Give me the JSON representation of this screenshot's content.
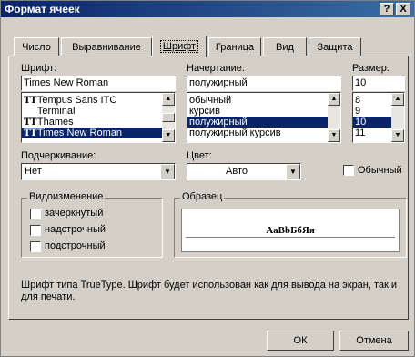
{
  "window": {
    "title": "Формат ячеек",
    "help": "?",
    "close": "X"
  },
  "tabs": [
    "Число",
    "Выравнивание",
    "Шрифт",
    "Граница",
    "Вид",
    "Защита"
  ],
  "font": {
    "label": "Шрифт:",
    "value": "Times New Roman",
    "items": [
      {
        "icon": "TT",
        "name": "Tempus Sans ITC"
      },
      {
        "icon": "",
        "name": "Terminal"
      },
      {
        "icon": "TT",
        "name": "Thames"
      },
      {
        "icon": "TT",
        "name": "Times New Roman"
      }
    ]
  },
  "style": {
    "label": "Начертание:",
    "value": "полужирный",
    "items": [
      "обычный",
      "курсив",
      "полужирный",
      "полужирный курсив"
    ]
  },
  "size": {
    "label": "Размер:",
    "value": "10",
    "items": [
      "8",
      "9",
      "10",
      "11"
    ]
  },
  "underline": {
    "label": "Подчеркивание:",
    "value": "Нет"
  },
  "color": {
    "label": "Цвет:",
    "value": "Авто"
  },
  "normal": {
    "label": "Обычный"
  },
  "effects": {
    "label": "Видоизменение",
    "items": [
      "зачеркнутый",
      "надстрочный",
      "подстрочный"
    ]
  },
  "sample": {
    "label": "Образец",
    "text": "AaBbБбЯя"
  },
  "note": "Шрифт типа TrueType. Шрифт будет использован как для вывода на экран, так и для печати.",
  "buttons": {
    "ok": "ОК",
    "cancel": "Отмена"
  }
}
